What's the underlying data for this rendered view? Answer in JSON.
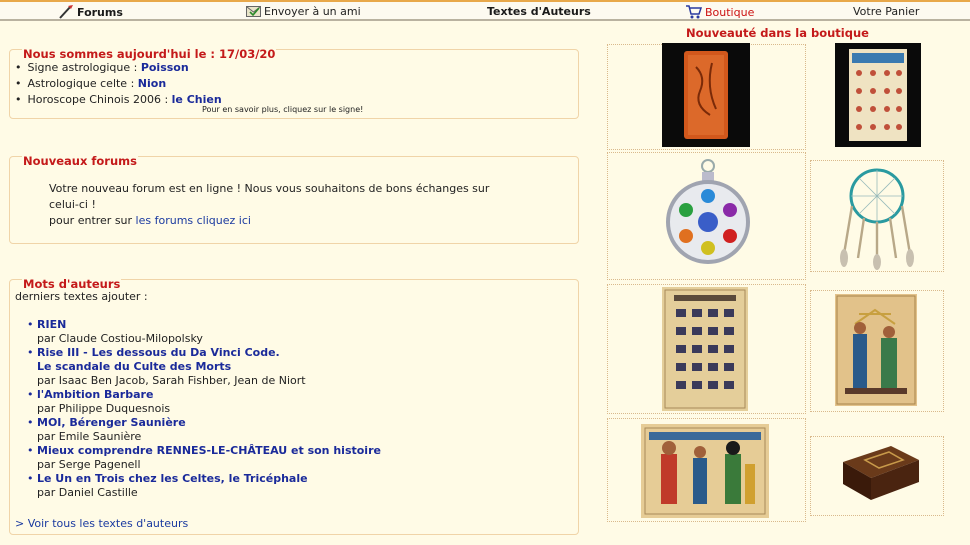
{
  "topbar": {
    "forums": "Forums",
    "envoyer": "Envoyer à un ami",
    "textes": "Textes d'Auteurs",
    "boutique": "Boutique",
    "panier": "Votre Panier"
  },
  "today": {
    "title": "Nous sommes aujourd'hui le : 17/03/20",
    "items": [
      {
        "label": "Signe astrologique : ",
        "value": "Poisson"
      },
      {
        "label": "Astrologique celte : ",
        "value": "Nion"
      },
      {
        "label": "Horoscope Chinois 2006 : ",
        "value": "le Chien"
      }
    ],
    "hint": "Pour en savoir plus, cliquez sur le signe!"
  },
  "forums": {
    "title": "Nouveaux forums",
    "line1": "Votre nouveau forum est en ligne ! Nous vous souhaitons de bons échanges sur",
    "line2": "celui-ci !",
    "line3_prefix": "pour entrer sur ",
    "link": "les forums cliquez ici"
  },
  "mots": {
    "title": "Mots d'auteurs",
    "subtitle": "derniers textes ajouter :",
    "texts": [
      {
        "title": "RIEN",
        "author": "par Claude Costiou-Milopolsky"
      },
      {
        "title": "Rise III - Les dessous du Da Vinci Code.",
        "title2": "Le scandale du Culte des Morts",
        "author": "par Isaac Ben Jacob, Sarah Fishber, Jean de Niort"
      },
      {
        "title": "l'Ambition Barbare",
        "author": "par Philippe Duquesnois"
      },
      {
        "title": "MOI, Bérenger Saunière",
        "author": "par Emile Saunière"
      },
      {
        "title": "Mieux comprendre RENNES-LE-CHÂTEAU et son histoire",
        "author": "par Serge Pagenell"
      },
      {
        "title": "Le Un en Trois chez les Celtes, le Tricéphale",
        "author": "par Daniel Castille"
      }
    ],
    "voir": "> Voir tous les textes d'auteurs"
  },
  "shop": {
    "title": "Nouveauté dans la boutique"
  }
}
